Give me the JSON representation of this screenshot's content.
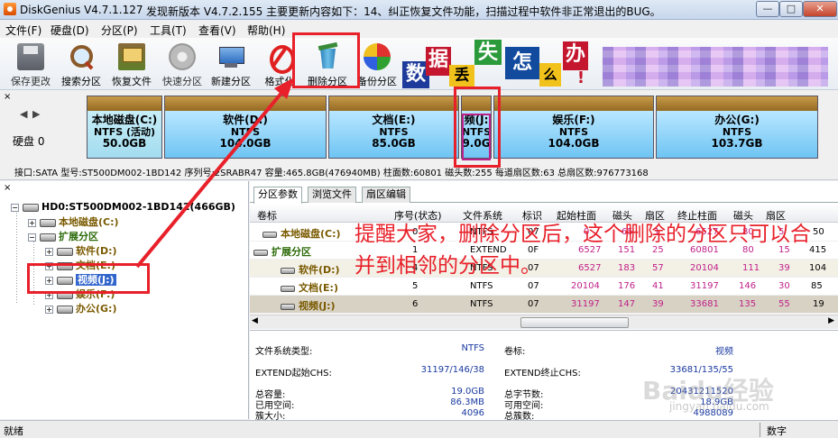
{
  "window": {
    "title": "DiskGenius V4.7.1.127",
    "notice": "发现新版本 V4.7.2.155 主要更新内容如下：14、纠正恢复文件功能，扫描过程中软件非正常退出的BUG。",
    "minimize": "—",
    "maximize": "□",
    "close": "✕"
  },
  "menu": [
    "文件(F)",
    "硬盘(D)",
    "分区(P)",
    "工具(T)",
    "查看(V)",
    "帮助(H)"
  ],
  "toolbar": [
    {
      "label": "保存更改",
      "icon": "save-icon"
    },
    {
      "label": "搜索分区",
      "icon": "search-partition-icon"
    },
    {
      "label": "恢复文件",
      "icon": "recover-files-icon"
    },
    {
      "label": "快速分区",
      "icon": "quick-partition-icon"
    },
    {
      "label": "新建分区",
      "icon": "new-partition-icon"
    },
    {
      "label": "格式化",
      "icon": "format-icon"
    },
    {
      "label": "删除分区",
      "icon": "delete-partition-icon"
    },
    {
      "label": "备份分区",
      "icon": "backup-partition-icon"
    }
  ],
  "banner": {
    "tiles": [
      "数",
      "据",
      "丢",
      "失",
      "怎",
      "么",
      "办",
      "!"
    ]
  },
  "disk_row": {
    "close": "×",
    "prev": "◀",
    "next": "▶",
    "disk_label": "硬盘 0",
    "partitions": [
      {
        "name": "本地磁盘(C:)",
        "fs": "NTFS (活动)",
        "size": "50.0GB"
      },
      {
        "name": "软件(D:)",
        "fs": "NTFS",
        "size": "104.0GB"
      },
      {
        "name": "文档(E:)",
        "fs": "NTFS",
        "size": "85.0GB"
      },
      {
        "name": "频(J:",
        "fs": "NTFS",
        "size": "9.0G"
      },
      {
        "name": "娱乐(F:)",
        "fs": "NTFS",
        "size": "104.0GB"
      },
      {
        "name": "办公(G:)",
        "fs": "NTFS",
        "size": "103.7GB"
      }
    ],
    "info": "接口:SATA  型号:ST500DM002-1BD142  序列号:2SRABR47  容量:465.8GB(476940MB)  柱面数:60801  磁头数:255  每道扇区数:63  总扇区数:976773168"
  },
  "tree": {
    "close": "×",
    "nodes": [
      {
        "label": "HD0:ST500DM002-1BD142(466GB)",
        "kind": "disk",
        "expander": "−"
      },
      {
        "label": "本地磁盘(C:)",
        "kind": "part",
        "expander": "+"
      },
      {
        "label": "扩展分区",
        "kind": "ext",
        "expander": "−"
      },
      {
        "label": "软件(D:)",
        "kind": "part",
        "expander": "+"
      },
      {
        "label": "文档(E:)",
        "kind": "part",
        "expander": "+"
      },
      {
        "label": "视频(J:)",
        "kind": "part",
        "expander": "+"
      },
      {
        "label": "娱乐(F:)",
        "kind": "part",
        "expander": "+"
      },
      {
        "label": "办公(G:)",
        "kind": "part",
        "expander": "+"
      }
    ]
  },
  "tabs": [
    "分区参数",
    "浏览文件",
    "扇区编辑"
  ],
  "grid": {
    "headers": [
      "卷标",
      "序号(状态)",
      "文件系统",
      "标识",
      "起始柱面",
      "磁头",
      "扇区",
      "终止柱面",
      "磁头",
      "扇区",
      ""
    ],
    "rows": [
      {
        "name": "本地磁盘(C:)",
        "idx": "0",
        "fs": "NTFS",
        "id": "07",
        "sc": "0",
        "sh": "65",
        "ss": "1",
        "ec": "6527",
        "eh": "80",
        "es": "5",
        "extra": "50"
      },
      {
        "name": "扩展分区",
        "idx": "1",
        "fs": "EXTEND",
        "id": "0F",
        "sc": "6527",
        "sh": "151",
        "ss": "25",
        "ec": "60801",
        "eh": "80",
        "es": "15",
        "extra": "415"
      },
      {
        "name": "软件(D:)",
        "idx": "4",
        "fs": "NTFS",
        "id": "07",
        "sc": "6527",
        "sh": "183",
        "ss": "57",
        "ec": "20104",
        "eh": "111",
        "es": "39",
        "extra": "104"
      },
      {
        "name": "文档(E:)",
        "idx": "5",
        "fs": "NTFS",
        "id": "07",
        "sc": "20104",
        "sh": "176",
        "ss": "41",
        "ec": "31197",
        "eh": "146",
        "es": "30",
        "extra": "85"
      },
      {
        "name": "视频(J:)",
        "idx": "6",
        "fs": "NTFS",
        "id": "07",
        "sc": "31197",
        "sh": "147",
        "ss": "39",
        "ec": "33681",
        "eh": "135",
        "es": "55",
        "extra": "19"
      }
    ]
  },
  "annotation": "提醒大家，删除分区后，这个删除的分区只可以合并到相邻的分区中。",
  "details": {
    "fs_type_label": "文件系统类型:",
    "fs_type": "NTFS",
    "volume_label": "卷标:",
    "volume": "视频",
    "ext_start_label": "EXTEND起始CHS:",
    "ext_start": "31197/146/38",
    "ext_end_label": "EXTEND终止CHS:",
    "ext_end": "33681/135/55",
    "total_label": "总容量:",
    "total": "19.0GB",
    "total_bytes_label": "总字节数:",
    "total_bytes": "20431211520",
    "used_label": "已用空间:",
    "used": "86.3MB",
    "free_label": "可用空间:",
    "free": "18.9GB",
    "cluster_label": "簇大小:",
    "cluster": "4096",
    "clusters_label": "总簇数:",
    "clusters": "4988089"
  },
  "status": {
    "text": "就绪",
    "mode": "数字"
  },
  "watermark": {
    "main": "Baidu经验",
    "sub": "jingyan.baidu.com"
  }
}
